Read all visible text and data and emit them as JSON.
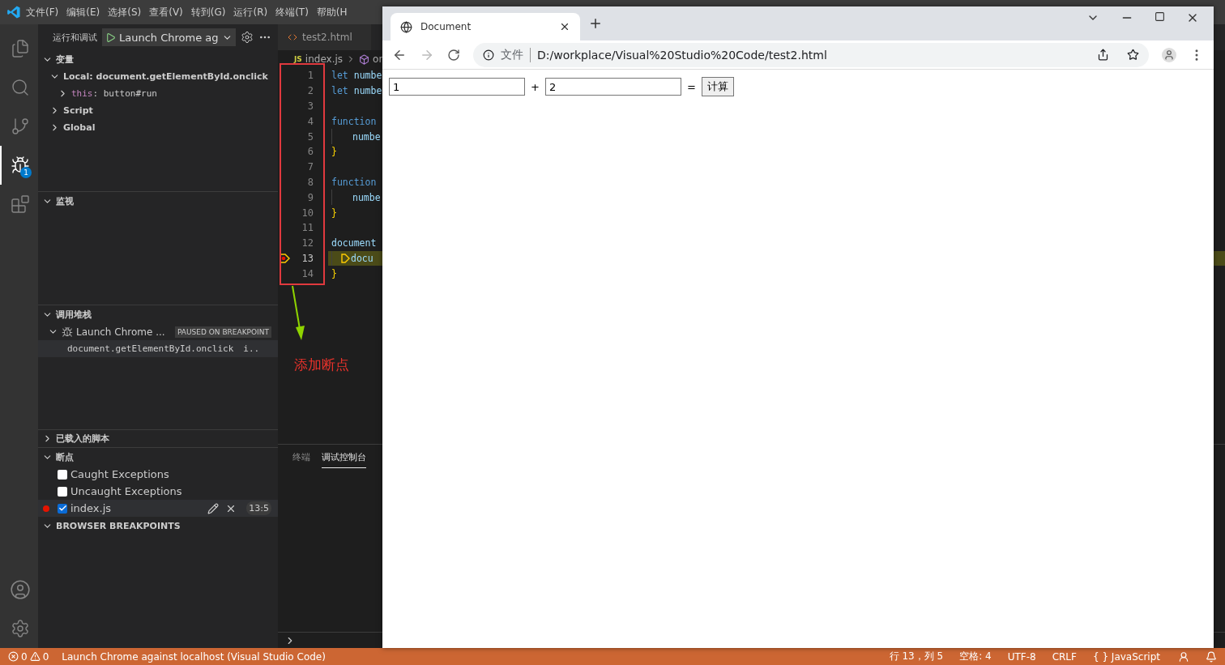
{
  "menu": [
    "文件(F)",
    "编辑(E)",
    "选择(S)",
    "查看(V)",
    "转到(G)",
    "运行(R)",
    "终端(T)",
    "帮助(H"
  ],
  "activity_bar": [
    {
      "kind": "explorer",
      "selected": false
    },
    {
      "kind": "search",
      "selected": false
    },
    {
      "kind": "source-control",
      "selected": false
    },
    {
      "kind": "debug",
      "selected": true,
      "badge": "1"
    },
    {
      "kind": "extensions",
      "selected": false
    }
  ],
  "sidebar": {
    "title": "运行和调试",
    "launch_config": "Launch Chrome ag",
    "variables": {
      "title": "变量",
      "expanded": true,
      "items": [
        {
          "label": "Local: document.getElementById.onclick",
          "expanded": true,
          "children": [
            {
              "label": "this",
              "separator": ":",
              "value": "button#run",
              "expanded": false
            }
          ]
        },
        {
          "label": "Script",
          "expanded": false
        },
        {
          "label": "Global",
          "expanded": false
        }
      ]
    },
    "watch": {
      "title": "监视",
      "expanded": true
    },
    "call_stack": {
      "title": "调用堆栈",
      "expanded": true,
      "session": {
        "name": "Launch Chrome ...",
        "status": "PAUSED ON BREAKPOINT",
        "expanded": true
      },
      "frames": [
        {
          "name": "document.getElementById.onclick",
          "file": "i.."
        }
      ]
    },
    "loaded_scripts": {
      "title": "已载入的脚本",
      "expanded": false
    },
    "breakpoints": {
      "title": "断点",
      "expanded": true,
      "items": [
        {
          "kind": "exception",
          "label": "Caught Exceptions",
          "checked": false
        },
        {
          "kind": "exception",
          "label": "Uncaught Exceptions",
          "checked": false
        },
        {
          "kind": "file",
          "label": "index.js",
          "checked": true,
          "position": "13:5"
        }
      ]
    },
    "browser_breakpoints": {
      "title": "BROWSER BREAKPOINTS",
      "expanded": true
    }
  },
  "editor": {
    "tab": "test2.html",
    "file_badge": "JS",
    "breadcrumb": [
      "index.js",
      "on"
    ],
    "lines": [
      {
        "number": "1",
        "indented": false,
        "paused": false,
        "tokens": [
          {
            "text": "let",
            "kind": "keyword"
          },
          {
            "text": "numbe",
            "kind": "variable"
          }
        ]
      },
      {
        "number": "2",
        "indented": false,
        "paused": false,
        "tokens": [
          {
            "text": "let",
            "kind": "keyword"
          },
          {
            "text": "numbe",
            "kind": "variable"
          }
        ]
      },
      {
        "number": "3",
        "indented": false,
        "paused": false
      },
      {
        "number": "4",
        "indented": false,
        "paused": false,
        "tokens": [
          {
            "text": "function",
            "kind": "keyword"
          }
        ]
      },
      {
        "number": "5",
        "indented": true,
        "paused": false,
        "tokens": [
          {
            "text": "numbe",
            "kind": "variable"
          }
        ]
      },
      {
        "number": "6",
        "indented": false,
        "paused": false,
        "tokens": [
          {
            "text": "}",
            "kind": "brace"
          }
        ]
      },
      {
        "number": "7",
        "indented": false,
        "paused": false
      },
      {
        "number": "8",
        "indented": false,
        "paused": false,
        "tokens": [
          {
            "text": "function",
            "kind": "keyword"
          }
        ]
      },
      {
        "number": "9",
        "indented": true,
        "paused": false,
        "tokens": [
          {
            "text": "numbe",
            "kind": "variable"
          }
        ]
      },
      {
        "number": "10",
        "indented": false,
        "paused": false,
        "tokens": [
          {
            "text": "}",
            "kind": "brace"
          }
        ]
      },
      {
        "number": "11",
        "indented": false,
        "paused": false
      },
      {
        "number": "12",
        "indented": false,
        "paused": false,
        "tokens": [
          {
            "text": "document",
            "kind": "variable"
          }
        ]
      },
      {
        "number": "13",
        "indented": true,
        "paused": true,
        "tokens": [
          {
            "text": "docu",
            "kind": "variable"
          }
        ]
      },
      {
        "number": "14",
        "indented": false,
        "paused": false,
        "tokens": [
          {
            "text": "}",
            "kind": "brace"
          }
        ]
      }
    ]
  },
  "annotation": {
    "label": "添加断点"
  },
  "panel": {
    "tabs": [
      {
        "label": "终端",
        "selected": false
      },
      {
        "label": "调试控制台",
        "selected": true
      }
    ]
  },
  "status_bar": {
    "errors": "0",
    "warnings": "0",
    "launch": "Launch Chrome against localhost (Visual Studio Code)",
    "right": [
      "行 13，列 5",
      "空格: 4",
      "UTF-8",
      "CRLF",
      "{ } JavaScript"
    ]
  },
  "browser": {
    "tab": "Document",
    "scheme": "文件",
    "url": "D:/workplace/Visual%20Studio%20Code/test2.html",
    "page": {
      "inputs": [
        "1",
        "2"
      ],
      "plus": "+",
      "equals": "=",
      "button": "计算"
    }
  }
}
